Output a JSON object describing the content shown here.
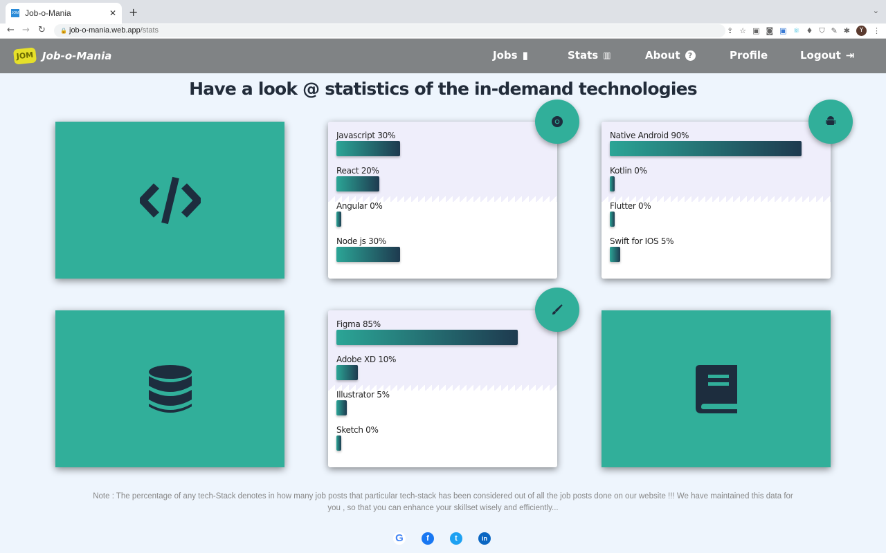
{
  "browser": {
    "tab_title": "Job-o-Mania",
    "url_host": "job-o-mania.web.app",
    "url_path": "/stats",
    "avatar_letter": "Y"
  },
  "header": {
    "brand": "Job-o-Mania",
    "logo_text": "JOM",
    "nav": [
      {
        "label": "Jobs",
        "icon": "briefcase-icon"
      },
      {
        "label": "Stats",
        "icon": "chart-icon"
      },
      {
        "label": "About",
        "icon": "question-circle-icon"
      },
      {
        "label": "Profile"
      },
      {
        "label": "Logout",
        "icon": "logout-icon"
      }
    ]
  },
  "title": "Have a look @ statistics of the in-demand technologies",
  "stats": [
    {
      "category": "web",
      "badge_icon": "chrome-icon",
      "items": [
        {
          "label": "Javascript 30%",
          "value": 30
        },
        {
          "label": "React 20%",
          "value": 20
        },
        {
          "label": "Angular 0%",
          "value": 0
        },
        {
          "label": "Node js 30%",
          "value": 30
        }
      ]
    },
    {
      "category": "mobile",
      "badge_icon": "android-icon",
      "items": [
        {
          "label": "Native Android 90%",
          "value": 90
        },
        {
          "label": "Kotlin 0%",
          "value": 0
        },
        {
          "label": "Flutter 0%",
          "value": 0
        },
        {
          "label": "Swift for IOS 5%",
          "value": 5
        }
      ]
    },
    {
      "category": "design",
      "badge_icon": "paintbrush-icon",
      "items": [
        {
          "label": "Figma 85%",
          "value": 85
        },
        {
          "label": "Adobe XD 10%",
          "value": 10
        },
        {
          "label": "Illustrator 5%",
          "value": 5
        },
        {
          "label": "Sketch 0%",
          "value": 0
        }
      ]
    }
  ],
  "icon_cards": [
    "code-icon",
    "database-icon",
    "book-icon"
  ],
  "colors": {
    "accent": "#31af9a",
    "header": "#808385",
    "bar_start": "#2ba596",
    "bar_end": "#1e3a4f"
  },
  "note": "Note : The percentage of any tech-Stack denotes in how many job posts that particular tech-stack has been considered out of all the job posts done on our website !!! We have maintained this data for you , so that you can enhance your skillset wisely and efficiently...",
  "social": [
    "google-icon",
    "facebook-icon",
    "twitter-icon",
    "linkedin-icon"
  ]
}
